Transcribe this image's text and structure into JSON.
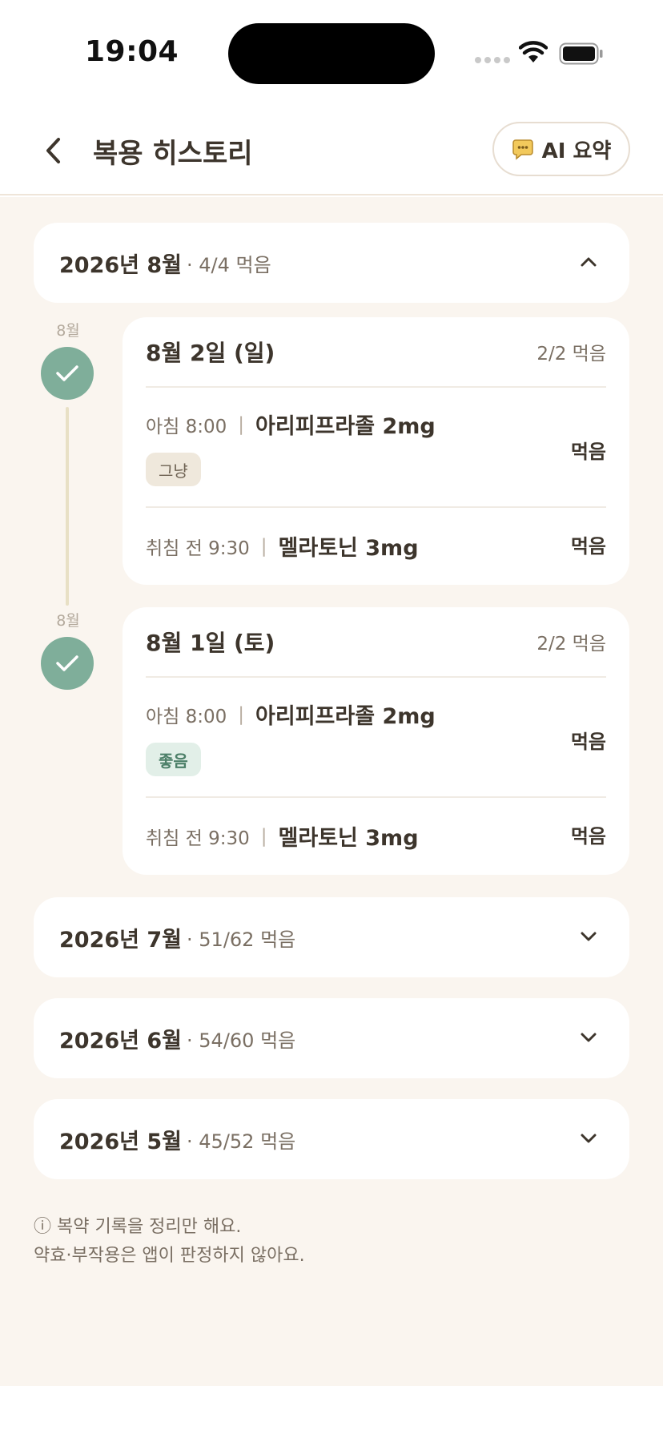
{
  "status_bar": {
    "time": "19:04"
  },
  "header": {
    "title": "복용 히스토리",
    "ai_button_label": "AI 요약"
  },
  "months": [
    {
      "title": "2026년 8월",
      "summary": "· 4/4 먹음",
      "expanded": true
    },
    {
      "title": "2026년 7월",
      "summary": "· 51/62 먹음",
      "expanded": false
    },
    {
      "title": "2026년 6월",
      "summary": "· 54/60 먹음",
      "expanded": false
    },
    {
      "title": "2026년 5월",
      "summary": "· 45/52 먹음",
      "expanded": false
    }
  ],
  "days": [
    {
      "timeline_label": "8월",
      "title": "8월 2일 (일)",
      "count": "2/2 먹음",
      "doses": [
        {
          "time": "아침 8:00",
          "med": "아리피프라졸 2mg",
          "status": "먹음",
          "chip": "그냥"
        },
        {
          "time": "취침 전 9:30",
          "med": "멜라토닌 3mg",
          "status": "먹음"
        }
      ]
    },
    {
      "timeline_label": "8월",
      "title": "8월 1일 (토)",
      "count": "2/2 먹음",
      "doses": [
        {
          "time": "아침 8:00",
          "med": "아리피프라졸 2mg",
          "status": "먹음",
          "chip": "좋음"
        },
        {
          "time": "취침 전 9:30",
          "med": "멜라토닌 3mg",
          "status": "먹음"
        }
      ]
    }
  ],
  "dose_separator": "|",
  "notice": {
    "line1": "ⓘ 복약 기록을 정리만 해요.",
    "line2": "약효·부작용은 앱이 판정하지 않아요."
  },
  "colors": {
    "accent_green": "#7fae9a",
    "background": "#faf5ef",
    "text_primary": "#3d352c",
    "text_secondary": "#7a6f63"
  }
}
